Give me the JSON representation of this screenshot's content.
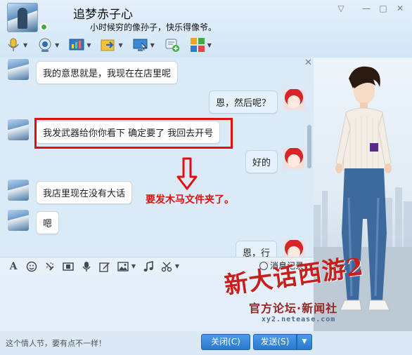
{
  "window": {
    "min_label": "—",
    "max_label": "□",
    "close_label": "✕",
    "dropdown_label": "▽"
  },
  "contact": {
    "name": "追梦赤子心",
    "signature": "小时候穷的像孙子，快乐得像爷。"
  },
  "toolbar": {
    "items": [
      {
        "icon": "microphone-icon"
      },
      {
        "icon": "webcam-icon"
      },
      {
        "icon": "app-share-icon"
      },
      {
        "icon": "send-file-icon"
      },
      {
        "icon": "remote-desktop-icon"
      },
      {
        "icon": "create-discussion-icon"
      },
      {
        "icon": "apps-icon"
      }
    ]
  },
  "messages": [
    {
      "side": "left",
      "text": "我的意思就是，我现在在店里呢"
    },
    {
      "side": "right",
      "text": "恩，然后呢？"
    },
    {
      "side": "left",
      "text": "我发武器给你你看下  确定要了  我回去开号"
    },
    {
      "side": "right",
      "text": "好的"
    },
    {
      "side": "left",
      "text": "我店里现在没有大话"
    },
    {
      "side": "left",
      "text": "嗯"
    },
    {
      "side": "right",
      "text": "恩，行"
    }
  ],
  "annotation": {
    "text": "要发木马文件夹了。",
    "color": "#e01010"
  },
  "input_toolbar": {
    "history_label": "消息记录",
    "icons": [
      "font-icon",
      "emoji-icon",
      "nudge-icon",
      "video-icon",
      "voice-icon",
      "edit-icon",
      "image-icon",
      "music-icon",
      "screenshot-icon"
    ]
  },
  "footer": {
    "ad_text": "这个情人节，要有点不一样！",
    "close_button": "关闭(C)",
    "send_button": "发送(S)",
    "send_arrow": "▼"
  },
  "watermark": {
    "main": "新大话西游2",
    "sub": "官方论坛·新闻社",
    "url": "xy2.netease.com"
  },
  "colors": {
    "accent_blue": "#2a79cf",
    "annotation_red": "#e01010"
  }
}
